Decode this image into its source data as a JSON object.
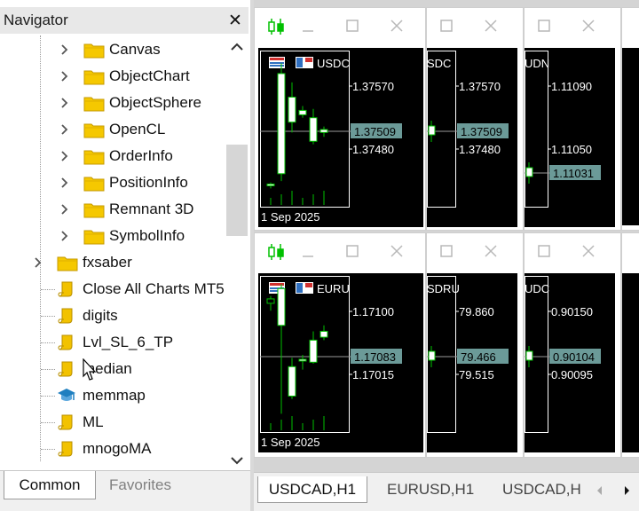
{
  "navigator": {
    "title": "Navigator",
    "close_glyph": "✕",
    "items": [
      {
        "label": "Canvas",
        "icon": "folder-icon",
        "level": 2,
        "expandable": true
      },
      {
        "label": "ObjectChart",
        "icon": "folder-icon",
        "level": 2,
        "expandable": true
      },
      {
        "label": "ObjectSphere",
        "icon": "folder-icon",
        "level": 2,
        "expandable": true
      },
      {
        "label": "OpenCL",
        "icon": "folder-icon",
        "level": 2,
        "expandable": true
      },
      {
        "label": "OrderInfo",
        "icon": "folder-icon",
        "level": 2,
        "expandable": true
      },
      {
        "label": "PositionInfo",
        "icon": "folder-icon",
        "level": 2,
        "expandable": true
      },
      {
        "label": "Remnant 3D",
        "icon": "folder-icon",
        "level": 2,
        "expandable": true
      },
      {
        "label": "SymbolInfo",
        "icon": "folder-icon",
        "level": 2,
        "expandable": true
      },
      {
        "label": "fxsaber",
        "icon": "folder-icon",
        "level": 1,
        "expandable": true
      },
      {
        "label": "Close All Charts MT5",
        "icon": "script-icon",
        "level": 1,
        "expandable": false
      },
      {
        "label": "digits",
        "icon": "script-icon",
        "level": 1,
        "expandable": false
      },
      {
        "label": "Lvl_SL_6_TP",
        "icon": "script-icon",
        "level": 1,
        "expandable": false
      },
      {
        "label": "median",
        "icon": "script-icon",
        "level": 1,
        "expandable": false
      },
      {
        "label": "memmap",
        "icon": "graduation-cap-icon",
        "level": 1,
        "expandable": false
      },
      {
        "label": "ML",
        "icon": "script-icon",
        "level": 1,
        "expandable": false
      },
      {
        "label": "mnogoMA",
        "icon": "script-icon",
        "level": 1,
        "expandable": false
      }
    ],
    "tabs": {
      "common": "Common",
      "favorites": "Favorites"
    }
  },
  "charts": [
    {
      "symbol_label": "USDC",
      "price_high": "1.37570",
      "price_low": "1.37480",
      "current": "1.37509",
      "date": "1 Sep 2025",
      "row": "top",
      "col": 0
    },
    {
      "symbol_label": "SDC",
      "price_high": "1.37570",
      "price_low": "1.37480",
      "current": "1.37509",
      "date": "",
      "row": "top",
      "col": 1
    },
    {
      "symbol_label": "UDN",
      "price_high": "1.11090",
      "price_low": "1.11050",
      "current": "1.11031",
      "date": "",
      "row": "top",
      "col": 2
    },
    {
      "symbol_label": "EURU",
      "price_high": "1.17100",
      "price_low": "1.17015",
      "current": "1.17083",
      "date": "1 Sep 2025",
      "row": "bottom",
      "col": 0
    },
    {
      "symbol_label": "SDRU",
      "price_high": "79.860",
      "price_low": "79.515",
      "current": "79.466",
      "date": "",
      "row": "bottom",
      "col": 1
    },
    {
      "symbol_label": "UDC",
      "price_high": "0.90150",
      "price_low": "0.90095",
      "current": "0.90104",
      "date": "",
      "row": "bottom",
      "col": 2
    }
  ],
  "chart_tabs": [
    "USDCAD,H1",
    "EURUSD,H1",
    "USDCAD,H"
  ],
  "colors": {
    "chart_bg": "#000000",
    "candle": "#00c000",
    "grid_text": "#ffffff",
    "price_tag": "#6b9a98",
    "folder": "#f5c800",
    "algo_icon": "#20a020"
  }
}
